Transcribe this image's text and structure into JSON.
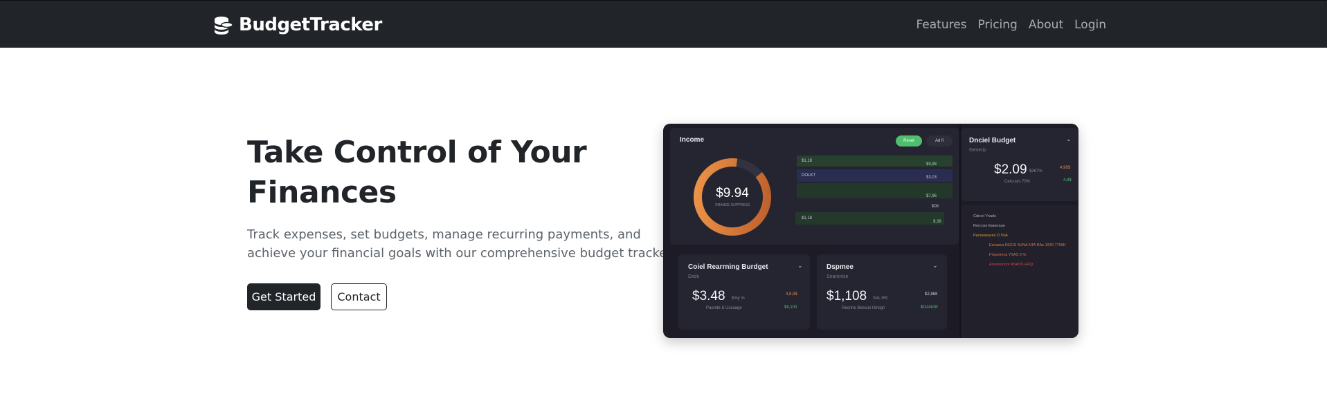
{
  "navbar": {
    "brand": "BudgetTracker",
    "brand_icon": "coins-stack-icon",
    "links": [
      "Features",
      "Pricing",
      "About",
      "Login"
    ]
  },
  "hero": {
    "title_line1": "Take Control of Your",
    "title_line2": "Finances",
    "subtitle": "Track expenses, set budgets, manage recurring payments, and achieve your financial goals with our comprehensive budget tracker.",
    "primary_button": "Get Started",
    "secondary_button": "Contact"
  },
  "dashboard": {
    "income": {
      "title": "Income",
      "pill_active": "Reset",
      "pill_other": "Ad fi",
      "donut_value": "$9.94",
      "donut_label": "ORANGE SUPPRESS",
      "donut_fill_fraction": 0.88,
      "bars": [
        {
          "label": "$1,18",
          "value": "$9,98"
        },
        {
          "label": "DOLKT",
          "value": "$3,03"
        },
        {
          "label": "",
          "value": "$7,96"
        },
        {
          "label": "",
          "value": "$08"
        },
        {
          "label": "$1,18",
          "value": "$,38"
        }
      ]
    },
    "right_top": {
      "title": "Dnciel Budget",
      "subtitle": "Generip",
      "amount": "$2.09",
      "amount_suffix": "$267%",
      "amount_note": "Cercusis 70%",
      "side_orange": "4,98$",
      "side_green": "4,8$"
    },
    "right_list": {
      "rows": [
        {
          "text": "Cdrcel Ynads",
          "color": "#8e8d9a"
        },
        {
          "text": "Rnrcnse Eaeeraue",
          "color": "#8e8d9a"
        },
        {
          "text": "Pacssasaces   O /%A",
          "color": "#d9a33c"
        },
        {
          "text": "Esnaaca   DGOS SVNA NTA RAs   1/DR 7709K",
          "color": "#e07a3a"
        },
        {
          "text": "Prepsirnca   YSAS   0 %",
          "color": "#e0704a"
        },
        {
          "text": "Ancsisnconr   ASASS ERQ",
          "color": "#d24a4a"
        }
      ]
    },
    "recurring": {
      "title": "Coiel Rearrning Burdget",
      "subtitle": "Dsde",
      "amount": "$3.48",
      "amount_suffix": "$%y %",
      "amount_note": "Pacrete & Uscaage",
      "side_orange": "4,8,9$",
      "side_green": "$9,100"
    },
    "expense": {
      "title": "Dspmee",
      "subtitle": "Searonise",
      "amount": "$1,108",
      "amount_suffix": "SAL:RS",
      "amount_note": "Recrine Beeciei Umiigh",
      "side_top": "$2,868",
      "side_green": "$OANGE"
    },
    "colors": {
      "background": "#1c1b26",
      "panel": "#252431",
      "accent_green": "#4fbf6d",
      "accent_orange": "#e8843c"
    }
  }
}
